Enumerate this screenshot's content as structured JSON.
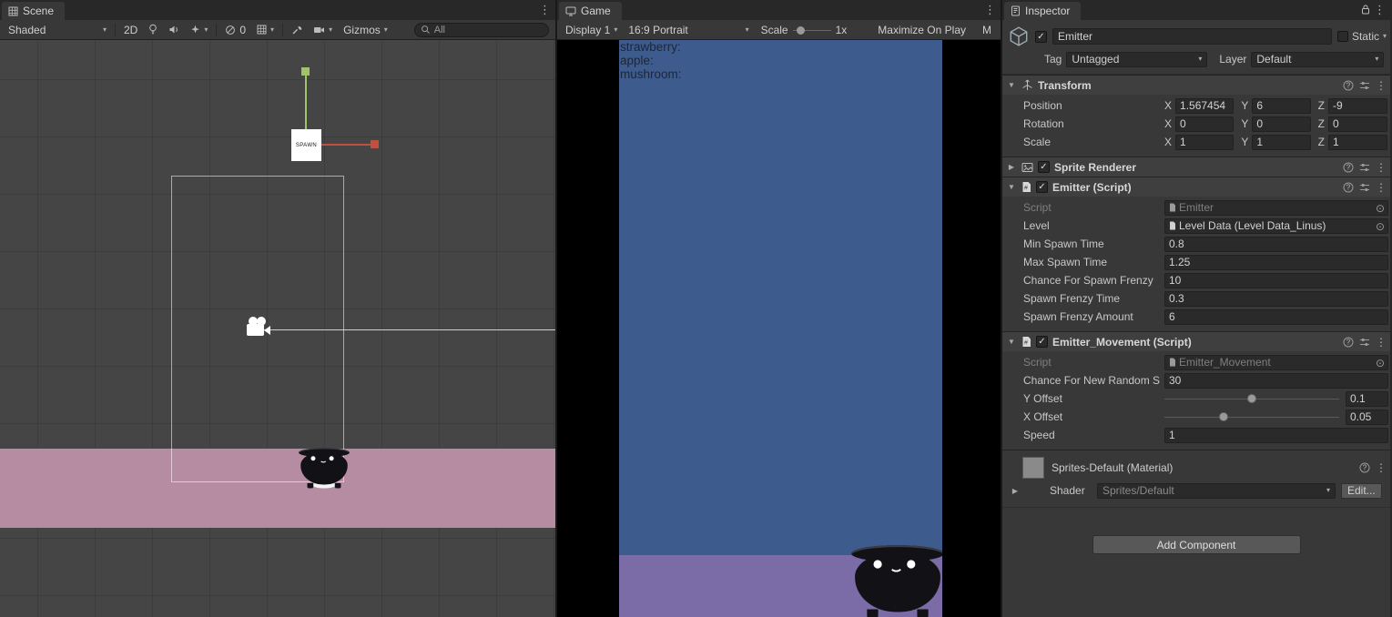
{
  "colors": {
    "game_sky": "#3E5B8D",
    "game_ground": "#7B6CA8",
    "scene_ground_pink": "#B58CA2",
    "axis_x_red": "#C05140",
    "axis_y_green": "#9EC36B"
  },
  "icons": {
    "kebab": "⋮",
    "caret": "▾",
    "foldout_open": "▼",
    "foldout_closed": "▶",
    "check": "✓",
    "object_picker": "⊙"
  },
  "scene": {
    "tab": "Scene",
    "toolbar": {
      "shading_mode": "Shaded",
      "mode_2d": "2D",
      "hidden_count": "0",
      "gizmos": "Gizmos",
      "search_value": "All"
    },
    "spawn_label": "SPAWN"
  },
  "game": {
    "tab": "Game",
    "toolbar": {
      "display": "Display 1",
      "aspect": "16:9 Portrait",
      "scale_label": "Scale",
      "scale_value": "1x",
      "maximize_on_play": "Maximize On Play",
      "clipped_item": "M"
    },
    "hud": [
      "strawberry:",
      "apple:",
      "mushroom:"
    ]
  },
  "inspector": {
    "tab": "Inspector",
    "header": {
      "name": "Emitter",
      "static_label": "Static",
      "tag_label": "Tag",
      "tag_value": "Untagged",
      "layer_label": "Layer",
      "layer_value": "Default"
    },
    "transform": {
      "title": "Transform",
      "axis": {
        "x": "X",
        "y": "Y",
        "z": "Z"
      },
      "rows": [
        {
          "label": "Position",
          "x": "1.567454",
          "y": "6",
          "z": "-9"
        },
        {
          "label": "Rotation",
          "x": "0",
          "y": "0",
          "z": "0"
        },
        {
          "label": "Scale",
          "x": "1",
          "y": "1",
          "z": "1"
        }
      ]
    },
    "sprite_renderer": {
      "title": "Sprite Renderer"
    },
    "emitter_script": {
      "title": "Emitter (Script)",
      "script_label": "Script",
      "script_value": "Emitter",
      "level_label": "Level",
      "level_value": "Level Data (Level Data_Linus)",
      "props": [
        {
          "label": "Min Spawn Time",
          "value": "0.8"
        },
        {
          "label": "Max Spawn Time",
          "value": "1.25"
        },
        {
          "label": "Chance For Spawn Frenzy",
          "value": "10"
        },
        {
          "label": "Spawn Frenzy Time",
          "value": "0.3"
        },
        {
          "label": "Spawn Frenzy Amount",
          "value": "6"
        }
      ]
    },
    "movement_script": {
      "title": "Emitter_Movement (Script)",
      "script_label": "Script",
      "script_value": "Emitter_Movement",
      "chance_label": "Chance For New Random S",
      "chance_value": "30",
      "y_offset_label": "Y Offset",
      "y_offset_value": "0.1",
      "x_offset_label": "X Offset",
      "x_offset_value": "0.05",
      "speed_label": "Speed",
      "speed_value": "1"
    },
    "material": {
      "title": "Sprites-Default (Material)",
      "shader_label": "Shader",
      "shader_value": "Sprites/Default",
      "edit_button": "Edit..."
    },
    "add_component_button": "Add Component"
  }
}
